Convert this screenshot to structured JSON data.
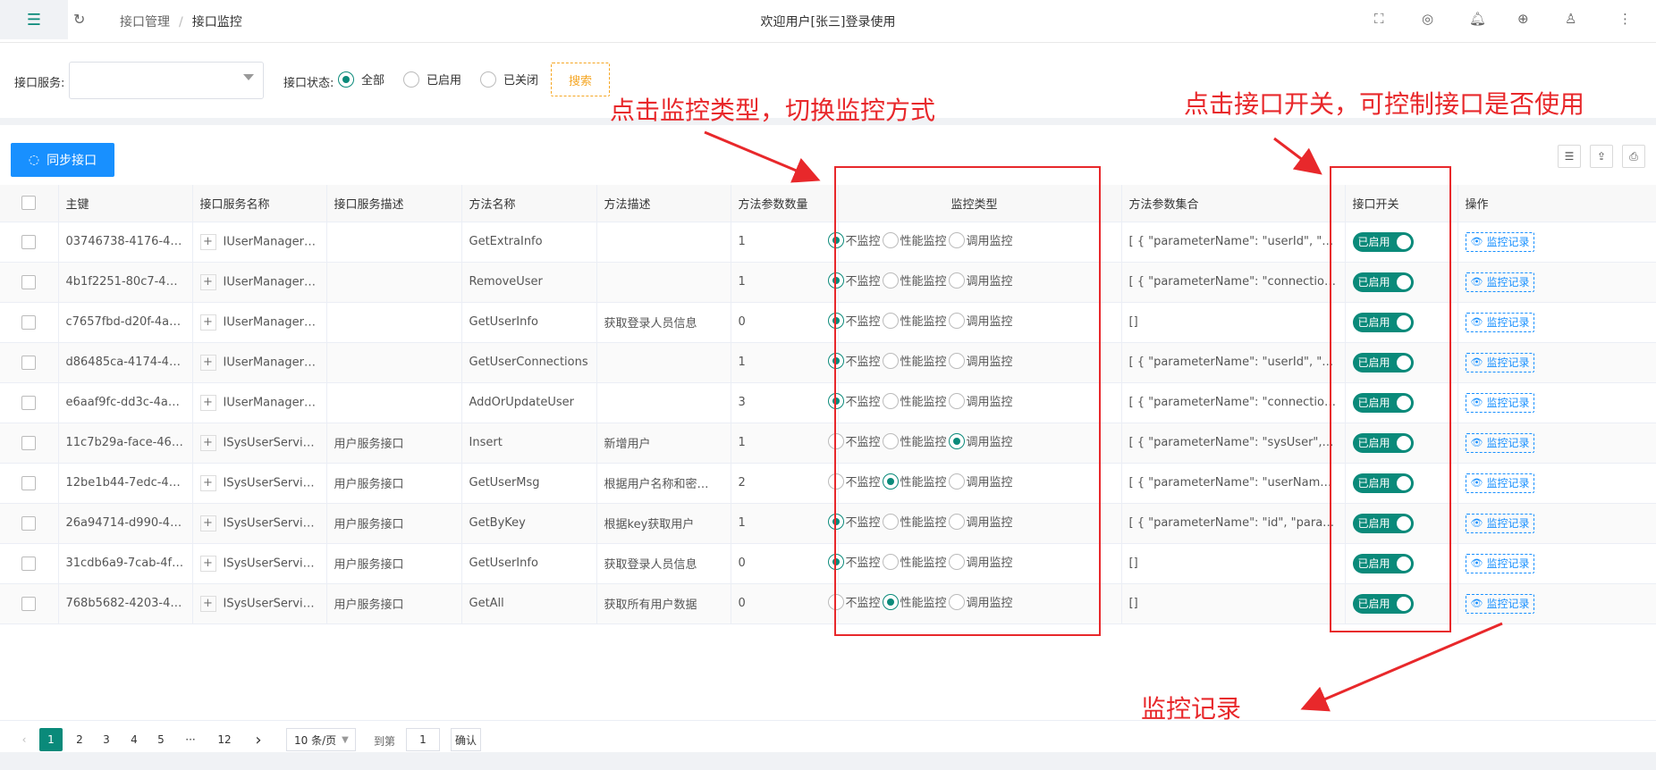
{
  "header": {
    "breadcrumb": [
      "接口管理",
      "接口监控"
    ],
    "breadcrumb_sep": "/",
    "welcome": "欢迎用户[张三]登录使用"
  },
  "filter": {
    "service_label": "接口服务:",
    "service_value": "",
    "status_label": "接口状态:",
    "status_options": [
      {
        "label": "全部",
        "checked": true
      },
      {
        "label": "已启用",
        "checked": false
      },
      {
        "label": "已关闭",
        "checked": false
      }
    ],
    "search_label": "搜索"
  },
  "toolbar": {
    "sync_label": "同步接口"
  },
  "table": {
    "columns": [
      "主键",
      "接口服务名称",
      "接口服务描述",
      "方法名称",
      "方法描述",
      "方法参数数量",
      "监控类型",
      "方法参数集合",
      "接口开关",
      "操作"
    ],
    "monitor_options": [
      "不监控",
      "性能监控",
      "调用监控"
    ],
    "switch_label": "已启用",
    "action_label": "监控记录",
    "rows": [
      {
        "id": "03746738-4176-43…",
        "service": "IUserManager…",
        "service_desc": "",
        "method": "GetExtraInfo",
        "method_desc": "",
        "param_count": "1",
        "monitor": 0,
        "params": "[ { \"parameterName\": \"userId\", \"par…"
      },
      {
        "id": "4b1f2251-80c7-44…",
        "service": "IUserManager…",
        "service_desc": "",
        "method": "RemoveUser",
        "method_desc": "",
        "param_count": "1",
        "monitor": 0,
        "params": "[ { \"parameterName\": \"connectionI…"
      },
      {
        "id": "c7657fbd-d20f-4ad…",
        "service": "IUserManager…",
        "service_desc": "",
        "method": "GetUserInfo",
        "method_desc": "获取登录人员信息",
        "param_count": "0",
        "monitor": 0,
        "params": "[]"
      },
      {
        "id": "d86485ca-4174-41…",
        "service": "IUserManager…",
        "service_desc": "",
        "method": "GetUserConnections",
        "method_desc": "",
        "param_count": "1",
        "monitor": 0,
        "params": "[ { \"parameterName\": \"userId\", \"par…"
      },
      {
        "id": "e6aaf9fc-dd3c-4a4…",
        "service": "IUserManager…",
        "service_desc": "",
        "method": "AddOrUpdateUser",
        "method_desc": "",
        "param_count": "3",
        "monitor": 0,
        "params": "[ { \"parameterName\": \"connectionI…"
      },
      {
        "id": "11c7b29a-face-46…",
        "service": "ISysUserServi…",
        "service_desc": "用户服务接口",
        "method": "Insert",
        "method_desc": "新增用户",
        "param_count": "1",
        "monitor": 2,
        "params": "[ { \"parameterName\": \"sysUser\", \"p…"
      },
      {
        "id": "12be1b44-7edc-45…",
        "service": "ISysUserServi…",
        "service_desc": "用户服务接口",
        "method": "GetUserMsg",
        "method_desc": "根据用户名称和密…",
        "param_count": "2",
        "monitor": 1,
        "params": "[ { \"parameterName\": \"userName\", …"
      },
      {
        "id": "26a94714-d990-40…",
        "service": "ISysUserServi…",
        "service_desc": "用户服务接口",
        "method": "GetByKey",
        "method_desc": "根据key获取用户",
        "param_count": "1",
        "monitor": 0,
        "params": "[ { \"parameterName\": \"id\", \"parame…"
      },
      {
        "id": "31cdb6a9-7cab-4f…",
        "service": "ISysUserServi…",
        "service_desc": "用户服务接口",
        "method": "GetUserInfo",
        "method_desc": "获取登录人员信息",
        "param_count": "0",
        "monitor": 0,
        "params": "[]"
      },
      {
        "id": "768b5682-4203-46…",
        "service": "ISysUserServi…",
        "service_desc": "用户服务接口",
        "method": "GetAll",
        "method_desc": "获取所有用户数据",
        "param_count": "0",
        "monitor": 1,
        "params": "[]"
      }
    ]
  },
  "pagination": {
    "pages": [
      "1",
      "2",
      "3",
      "4",
      "5",
      "···",
      "12"
    ],
    "current": "1",
    "page_size": "10 条/页",
    "jump_label": "到第",
    "jump_value": "1",
    "confirm_label": "确认"
  },
  "annotations": {
    "monitor_note": "点击监控类型，切换监控方式",
    "switch_note": "点击接口开关，可控制接口是否使用",
    "record_note": "监控记录"
  },
  "colors": {
    "primary": "#0a8a7a",
    "blue": "#1890ff",
    "annotation": "#e8282b",
    "search_btn": "#f5a623"
  }
}
